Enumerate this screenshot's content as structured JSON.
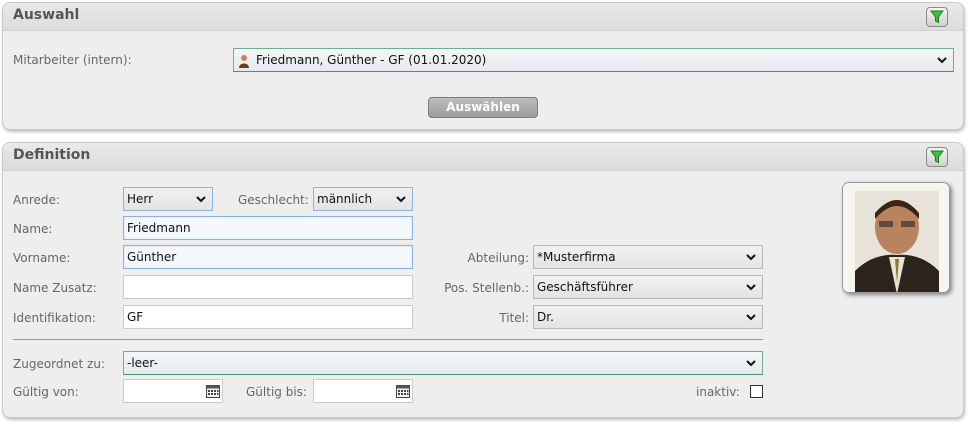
{
  "auswahl": {
    "title": "Auswahl",
    "filter_icon": "funnel-icon",
    "mitarbeiter_label": "Mitarbeiter (intern):",
    "mitarbeiter_value": "Friedmann, Günther - GF (01.01.2020)",
    "auswaehlen_button": "Auswählen"
  },
  "definition": {
    "title": "Definition",
    "filter_icon": "funnel-icon",
    "anrede_label": "Anrede:",
    "anrede_value": "Herr",
    "geschlecht_label": "Geschlecht:",
    "geschlecht_value": "männlich",
    "name_label": "Name:",
    "name_value": "Friedmann",
    "vorname_label": "Vorname:",
    "vorname_value": "Günther",
    "name_zusatz_label": "Name Zusatz:",
    "name_zusatz_value": "",
    "identifikation_label": "Identifikation:",
    "identifikation_value": "GF",
    "abteilung_label": "Abteilung:",
    "abteilung_value": "*Musterfirma",
    "pos_stellenb_label": "Pos. Stellenb.:",
    "pos_stellenb_value": "Geschäftsführer",
    "titel_label": "Titel:",
    "titel_value": "Dr.",
    "zugeordnet_label": "Zugeordnet zu:",
    "zugeordnet_value": "-leer-",
    "gueltig_von_label": "Gültig von:",
    "gueltig_von_value": "",
    "gueltig_bis_label": "Gültig bis:",
    "gueltig_bis_value": "",
    "inaktiv_label": "inaktiv:",
    "inaktiv_checked": false
  },
  "colors": {
    "filter_green": "#3fbf3f",
    "header_text": "#555555",
    "panel_bg": "#eeeeee"
  }
}
